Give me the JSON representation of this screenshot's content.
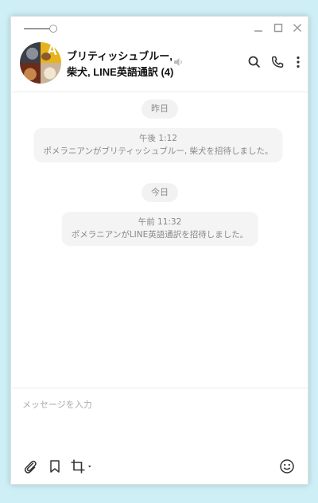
{
  "chat": {
    "title": "ブリティッシュブルー, 柴犬, LINE英語通訳 (4)"
  },
  "messages": [
    {
      "date": "昨日",
      "time": "午後 1:12",
      "text": "ポメラニアンがブリティッシュブルー, 柴犬を招待しました。"
    },
    {
      "date": "今日",
      "time": "午前 11:32",
      "text": "ポメラニアンがLINE英語通訳を招待しました。"
    }
  ],
  "input": {
    "placeholder": "メッセージを入力"
  },
  "avatar": {
    "letter": "A"
  },
  "icons": {
    "window": [
      "opacity-slider-icon",
      "minimize-icon",
      "maximize-icon",
      "close-icon"
    ],
    "header": [
      "mute-icon",
      "search-icon",
      "phone-icon",
      "more-vertical-icon"
    ],
    "toolbar": [
      "paperclip-icon",
      "bookmark-icon",
      "crop-icon",
      "emoji-icon"
    ]
  },
  "colors": {
    "background": "#cdeff5",
    "bubble": "#f4f4f5",
    "muted_text": "#888888"
  }
}
